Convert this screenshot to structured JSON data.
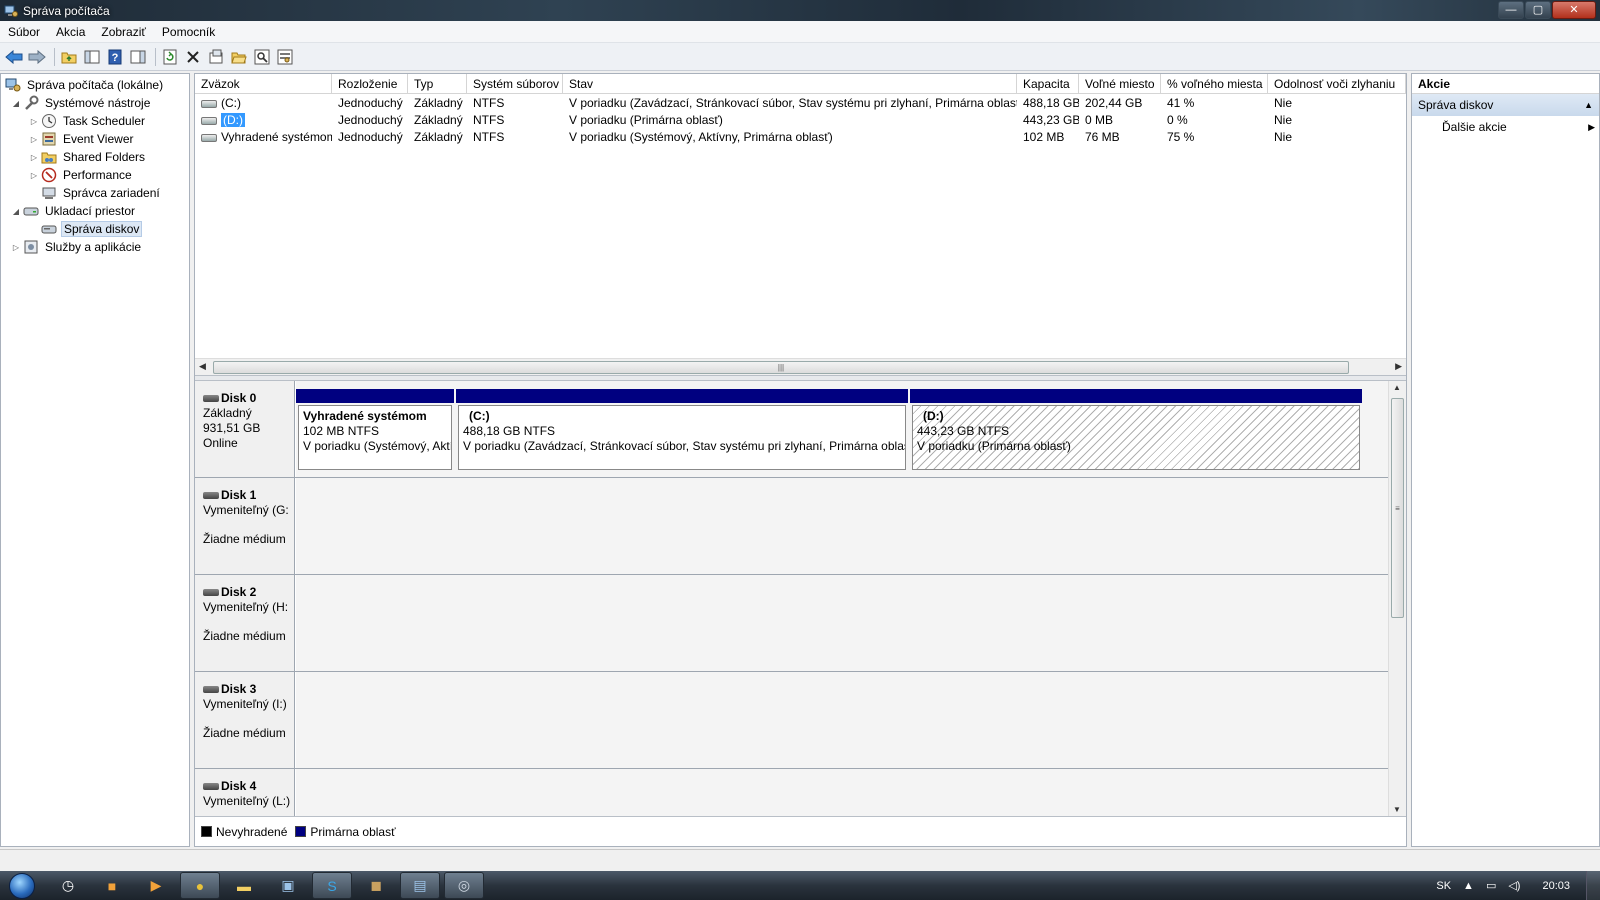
{
  "window": {
    "title": "Správa počítača",
    "minimize": "—",
    "maximize": "▢",
    "close": "✕"
  },
  "menu": [
    "Súbor",
    "Akcia",
    "Zobraziť",
    "Pomocník"
  ],
  "toolbar_icons": [
    "back-icon",
    "forward-icon",
    "up-folder-icon",
    "show-tree-icon",
    "help-icon",
    "console-icon",
    "refresh-icon",
    "delete-icon",
    "properties-icon",
    "open-icon",
    "search-icon",
    "settings-icon"
  ],
  "tree": [
    {
      "label": "Správa počítača (lokálne)",
      "level": 0,
      "twisty": "",
      "icon": "computer-icon"
    },
    {
      "label": "Systémové nástroje",
      "level": 1,
      "twisty": "◢",
      "icon": "tools-icon"
    },
    {
      "label": "Task Scheduler",
      "level": 2,
      "twisty": "▷",
      "icon": "clock-icon"
    },
    {
      "label": "Event Viewer",
      "level": 2,
      "twisty": "▷",
      "icon": "event-icon"
    },
    {
      "label": "Shared Folders",
      "level": 2,
      "twisty": "▷",
      "icon": "shared-folder-icon"
    },
    {
      "label": "Performance",
      "level": 2,
      "twisty": "▷",
      "icon": "performance-icon"
    },
    {
      "label": "Správca zariadení",
      "level": 2,
      "twisty": "",
      "icon": "device-manager-icon"
    },
    {
      "label": "Ukladací priestor",
      "level": 1,
      "twisty": "◢",
      "icon": "storage-icon"
    },
    {
      "label": "Správa diskov",
      "level": 2,
      "twisty": "",
      "icon": "disk-icon",
      "selected": true
    },
    {
      "label": "Služby a aplikácie",
      "level": 1,
      "twisty": "▷",
      "icon": "services-icon"
    }
  ],
  "volumes": {
    "columns": [
      "Zväzok",
      "Rozloženie",
      "Typ",
      "Systém súborov",
      "Stav",
      "Kapacita",
      "Voľné miesto",
      "% voľného miesta",
      "Odolnosť voči zlyhaniu"
    ],
    "rows": [
      [
        "(C:)",
        "Jednoduchý",
        "Základný",
        "NTFS",
        "V poriadku (Zavádzací, Stránkovací súbor, Stav systému pri zlyhaní, Primárna oblasť)",
        "488,18 GB",
        "202,44 GB",
        "41 %",
        "Nie"
      ],
      [
        "(D:)",
        "Jednoduchý",
        "Základný",
        "NTFS",
        "V poriadku (Primárna oblasť)",
        "443,23 GB",
        "0 MB",
        "0 %",
        "Nie"
      ],
      [
        "Vyhradené systémom",
        "Jednoduchý",
        "Základný",
        "NTFS",
        "V poriadku (Systémový, Aktívny, Primárna oblasť)",
        "102 MB",
        "76 MB",
        "75 %",
        "Nie"
      ]
    ],
    "selected_row": 1
  },
  "disks": [
    {
      "name": "Disk 0",
      "lines": [
        "Základný",
        "931,51 GB",
        "Online"
      ],
      "partitions": [
        {
          "name": "Vyhradené systémom",
          "size": "102 MB NTFS",
          "status": "V poriadku (Systémový, Aktí",
          "bold": true
        },
        {
          "name": "(C:)",
          "size": "488,18 GB NTFS",
          "status": "V poriadku (Zavádzací, Stránkovací súbor, Stav systému pri zlyhaní, Primárna oblasť)"
        },
        {
          "name": "(D:)",
          "size": "443,23 GB NTFS",
          "status": "V poriadku (Primárna oblasť)",
          "hatched": true
        }
      ]
    },
    {
      "name": "Disk 1",
      "lines": [
        "Vymeniteľný (G:",
        "",
        "Žiadne médium"
      ]
    },
    {
      "name": "Disk 2",
      "lines": [
        "Vymeniteľný (H:",
        "",
        "Žiadne médium"
      ]
    },
    {
      "name": "Disk 3",
      "lines": [
        "Vymeniteľný (I:)",
        "",
        "Žiadne médium"
      ]
    },
    {
      "name": "Disk 4",
      "lines": [
        "Vymeniteľný (L:)",
        "",
        ""
      ]
    }
  ],
  "legend": [
    {
      "label": "Nevyhradené",
      "color": "#000000"
    },
    {
      "label": "Primárna oblasť",
      "color": "#000080"
    }
  ],
  "actions": {
    "header": "Akcie",
    "section": "Správa diskov",
    "items": [
      "Ďalšie akcie"
    ]
  },
  "tray": {
    "language": "SK",
    "time": "20:03"
  }
}
